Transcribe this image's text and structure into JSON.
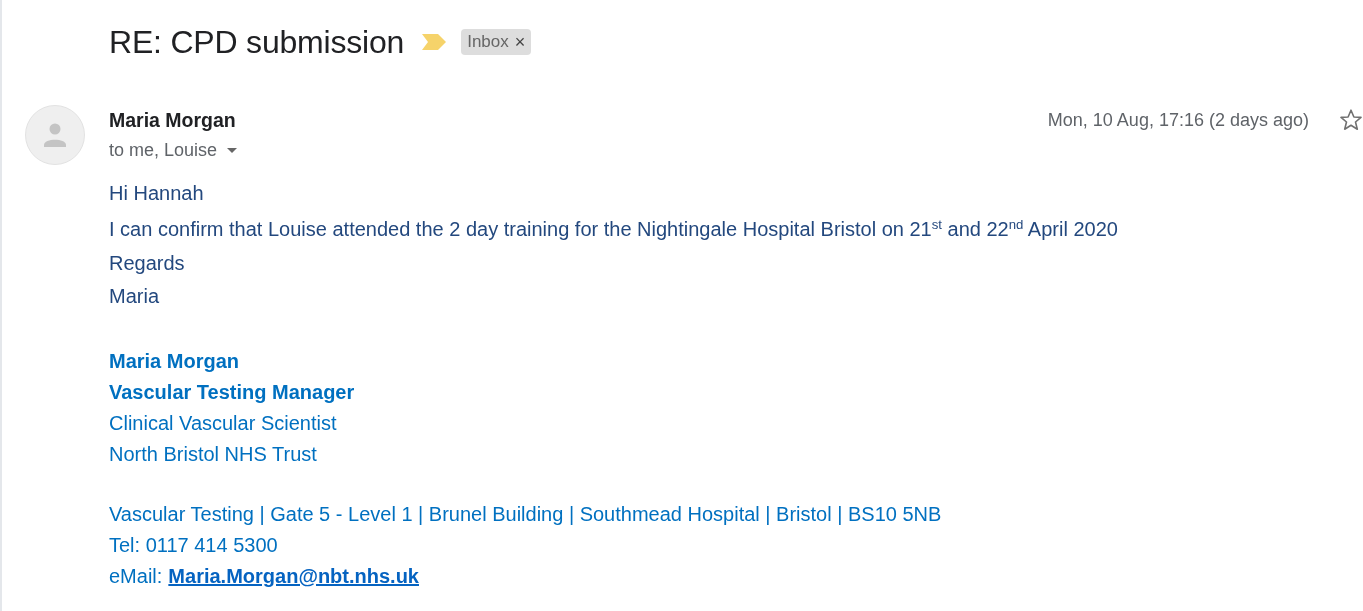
{
  "subject": {
    "title": "RE: CPD submission",
    "important": true,
    "labels": [
      {
        "text": "Inbox",
        "remove": "×"
      }
    ]
  },
  "message": {
    "sender": "Maria Morgan",
    "recipients": "to me, Louise",
    "date": "Mon, 10 Aug, 17:16 (2 days ago)",
    "starred": false,
    "body": [
      "Hi Hannah",
      "I can confirm that Louise attended the 2 day training for the Nightingale Hospital Bristol on 21$^{st}$ and 22$^{nd}$ April 2020",
      "Regards",
      "Maria"
    ],
    "signature": [
      {
        "lines": [
          {
            "kind": "bold",
            "text": "Maria Morgan"
          },
          {
            "kind": "bold",
            "text": "Vascular Testing Manager"
          },
          {
            "kind": "plain",
            "text": "Clinical Vascular Scientist"
          },
          {
            "kind": "plain",
            "text": "North Bristol NHS Trust"
          }
        ]
      },
      {
        "lines": [
          {
            "kind": "plain",
            "text": "Vascular Testing | Gate 5 - Level 1 | Brunel Building | Southmead Hospital | Bristol | BS10 5NB"
          },
          {
            "kind": "plain",
            "text": "Tel: 0117 414 5300"
          },
          {
            "kind": "email",
            "label": "eMail:",
            "link": "Maria.Morgan@nbt.nhs.uk"
          }
        ]
      }
    ]
  }
}
